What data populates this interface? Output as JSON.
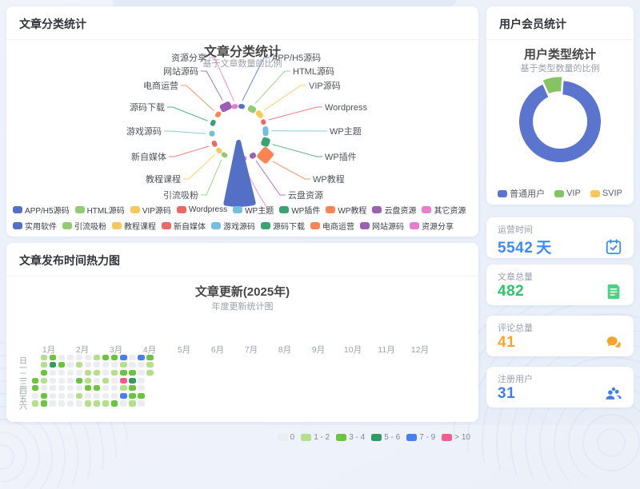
{
  "category_panel": {
    "header": "文章分类统计",
    "chart_data": {
      "type": "pie",
      "variant": "nightingale-rose",
      "title": "文章分类统计",
      "subtitle": "基于文章数量的比例",
      "legend_position": "bottom",
      "series": [
        {
          "name": "APP/H5源码",
          "value": 8,
          "color": "#5470c6"
        },
        {
          "name": "HTML源码",
          "value": 14,
          "color": "#91cc75"
        },
        {
          "name": "VIP源码",
          "value": 12,
          "color": "#fac858"
        },
        {
          "name": "Wordpress",
          "value": 6,
          "color": "#ee6666"
        },
        {
          "name": "WP主题",
          "value": 12,
          "color": "#73c0de"
        },
        {
          "name": "WP插件",
          "value": 18,
          "color": "#3ba272"
        },
        {
          "name": "WP教程",
          "value": 52,
          "color": "#fc8452"
        },
        {
          "name": "云盘资源",
          "value": 8,
          "color": "#9a60b4"
        },
        {
          "name": "其它资源",
          "value": 5,
          "color": "#ea7ccc"
        },
        {
          "name": "实用软件",
          "value": 260,
          "color": "#5470c6"
        },
        {
          "name": "引流吸粉",
          "value": 7,
          "color": "#91cc75"
        },
        {
          "name": "教程课程",
          "value": 6,
          "color": "#fac858"
        },
        {
          "name": "新自媒体",
          "value": 6,
          "color": "#ee6666"
        },
        {
          "name": "游戏源码",
          "value": 5,
          "color": "#73c0de"
        },
        {
          "name": "源码下载",
          "value": 7,
          "color": "#3ba272"
        },
        {
          "name": "电商运营",
          "value": 8,
          "color": "#fc8452"
        },
        {
          "name": "网站源码",
          "value": 26,
          "color": "#9a60b4"
        },
        {
          "name": "资源分享",
          "value": 9,
          "color": "#ea7ccc"
        }
      ]
    }
  },
  "member_panel": {
    "header": "用户会员统计",
    "chart_data": {
      "type": "pie",
      "variant": "donut",
      "title": "用户类型统计",
      "subtitle": "基于类型数量的比例",
      "legend_position": "bottom",
      "series": [
        {
          "name": "普通用户",
          "value": 29,
          "percent": 92.2,
          "color": "#5b74ce"
        },
        {
          "name": "VIP",
          "value": 2,
          "percent": 7.8,
          "color": "#85c460"
        },
        {
          "name": "SVIP",
          "value": 0,
          "percent": 0,
          "color": "#fac858"
        }
      ]
    }
  },
  "heatmap_panel": {
    "header": "文章发布时间热力图",
    "chart_data": {
      "type": "heatmap",
      "variant": "calendar",
      "title": "文章更新(2025年)",
      "subtitle": "年度更新统计图",
      "months": [
        "1月",
        "2月",
        "3月",
        "4月",
        "5月",
        "6月",
        "7月",
        "8月",
        "9月",
        "10月",
        "11月",
        "12月"
      ],
      "days": [
        "日",
        "一",
        "二",
        "三",
        "四",
        "五",
        "六"
      ],
      "palette": [
        "#ebedf0",
        "#b5e08b",
        "#69c53e",
        "#2f9d63",
        "#4480ef",
        "#f55c8d"
      ],
      "matrix": [
        [
          -1,
          1,
          2,
          0,
          0,
          0,
          0,
          1,
          2,
          2,
          4,
          0,
          4,
          2
        ],
        [
          -1,
          1,
          3,
          2,
          0,
          1,
          0,
          0,
          0,
          0,
          1,
          0,
          0,
          1
        ],
        [
          -1,
          2,
          0,
          0,
          0,
          0,
          1,
          1,
          0,
          1,
          2,
          2,
          0,
          1
        ],
        [
          2,
          1,
          0,
          0,
          0,
          2,
          1,
          0,
          1,
          0,
          5,
          3,
          0,
          -1
        ],
        [
          2,
          0,
          0,
          0,
          0,
          0,
          2,
          2,
          0,
          0,
          1,
          2,
          0,
          -1
        ],
        [
          0,
          2,
          0,
          0,
          0,
          1,
          0,
          0,
          0,
          0,
          4,
          2,
          2,
          -1
        ],
        [
          1,
          2,
          0,
          0,
          0,
          0,
          1,
          1,
          1,
          2,
          0,
          1,
          0,
          -1
        ]
      ],
      "legend": [
        {
          "label": "0",
          "color": "#ebedf0"
        },
        {
          "label": "1 - 2",
          "color": "#b5e08b"
        },
        {
          "label": "3 - 4",
          "color": "#69c53e"
        },
        {
          "label": "5 - 6",
          "color": "#2f9d63"
        },
        {
          "label": "7 - 9",
          "color": "#4480ef"
        },
        {
          "label": "> 10",
          "color": "#f55c8d"
        }
      ]
    }
  },
  "stats": [
    {
      "label": "运营时间",
      "value": "5542",
      "suffix": "天",
      "color": "#3d8af5",
      "icon": "calendar-check-icon"
    },
    {
      "label": "文章总量",
      "value": "482",
      "suffix": "",
      "color": "#2ac769",
      "icon": "document-icon"
    },
    {
      "label": "评论总量",
      "value": "41",
      "suffix": "",
      "color": "#f7a428",
      "icon": "comments-icon"
    },
    {
      "label": "注册用户",
      "value": "31",
      "suffix": "",
      "color": "#3f7ee8",
      "icon": "users-group-icon"
    }
  ]
}
